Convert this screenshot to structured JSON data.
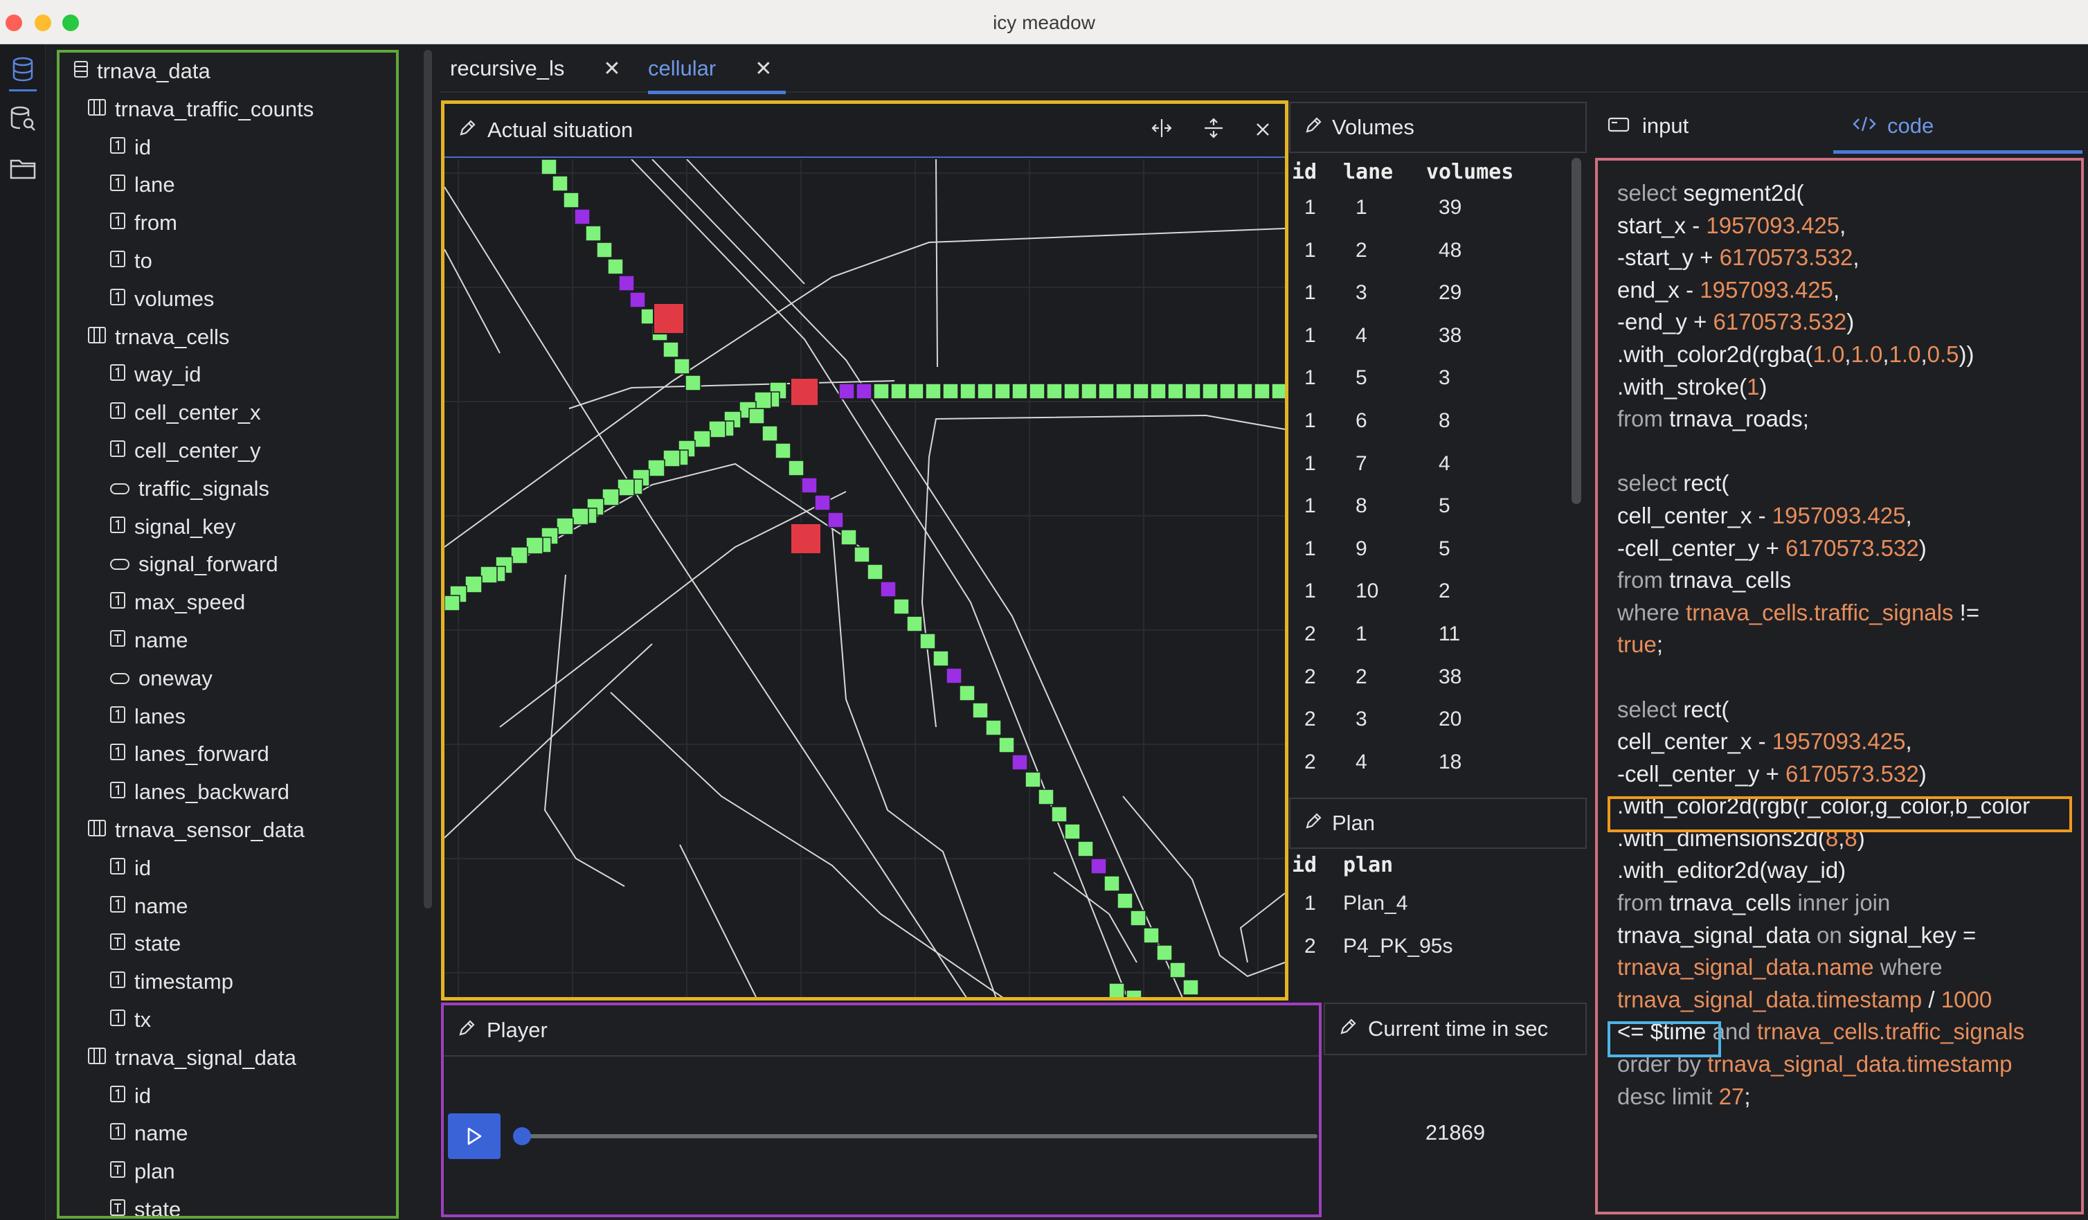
{
  "window": {
    "title": "icy meadow"
  },
  "rail": {
    "items": [
      "database-icon",
      "database-search-icon",
      "folder-icon"
    ]
  },
  "tree": {
    "items": [
      {
        "label": "trnava_data",
        "icon": "database-icon",
        "level": 0
      },
      {
        "label": "trnava_traffic_counts",
        "icon": "table-icon",
        "level": 1
      },
      {
        "label": "id",
        "icon": "number-icon",
        "level": 2
      },
      {
        "label": "lane",
        "icon": "number-icon",
        "level": 2
      },
      {
        "label": "from",
        "icon": "number-icon",
        "level": 2
      },
      {
        "label": "to",
        "icon": "number-icon",
        "level": 2
      },
      {
        "label": "volumes",
        "icon": "number-icon",
        "level": 2
      },
      {
        "label": "trnava_cells",
        "icon": "table-icon",
        "level": 1
      },
      {
        "label": "way_id",
        "icon": "number-icon",
        "level": 2
      },
      {
        "label": "cell_center_x",
        "icon": "number-icon",
        "level": 2
      },
      {
        "label": "cell_center_y",
        "icon": "number-icon",
        "level": 2
      },
      {
        "label": "traffic_signals",
        "icon": "boolean-icon",
        "level": 2
      },
      {
        "label": "signal_key",
        "icon": "number-icon",
        "level": 2
      },
      {
        "label": "signal_forward",
        "icon": "boolean-icon",
        "level": 2
      },
      {
        "label": "max_speed",
        "icon": "number-icon",
        "level": 2
      },
      {
        "label": "name",
        "icon": "text-icon",
        "level": 2
      },
      {
        "label": "oneway",
        "icon": "boolean-icon",
        "level": 2
      },
      {
        "label": "lanes",
        "icon": "number-icon",
        "level": 2
      },
      {
        "label": "lanes_forward",
        "icon": "number-icon",
        "level": 2
      },
      {
        "label": "lanes_backward",
        "icon": "number-icon",
        "level": 2
      },
      {
        "label": "trnava_sensor_data",
        "icon": "table-icon",
        "level": 1
      },
      {
        "label": "id",
        "icon": "number-icon",
        "level": 2
      },
      {
        "label": "name",
        "icon": "number-icon",
        "level": 2
      },
      {
        "label": "state",
        "icon": "text-icon",
        "level": 2
      },
      {
        "label": "timestamp",
        "icon": "number-icon",
        "level": 2
      },
      {
        "label": "tx",
        "icon": "number-icon",
        "level": 2
      },
      {
        "label": "trnava_signal_data",
        "icon": "table-icon",
        "level": 1
      },
      {
        "label": "id",
        "icon": "number-icon",
        "level": 2
      },
      {
        "label": "name",
        "icon": "number-icon",
        "level": 2
      },
      {
        "label": "plan",
        "icon": "text-icon",
        "level": 2
      },
      {
        "label": "state",
        "icon": "text-icon",
        "level": 2
      }
    ]
  },
  "tabs": [
    {
      "label": "recursive_ls",
      "close": "✕",
      "active": false
    },
    {
      "label": "cellular",
      "close": "✕",
      "active": true
    }
  ],
  "map_panel": {
    "title": "Actual situation"
  },
  "volumes_panel": {
    "title": "Volumes",
    "columns": [
      "id",
      "lane",
      "volumes"
    ],
    "rows": [
      [
        "1",
        "1",
        "39"
      ],
      [
        "1",
        "2",
        "48"
      ],
      [
        "1",
        "3",
        "29"
      ],
      [
        "1",
        "4",
        "38"
      ],
      [
        "1",
        "5",
        "3"
      ],
      [
        "1",
        "6",
        "8"
      ],
      [
        "1",
        "7",
        "4"
      ],
      [
        "1",
        "8",
        "5"
      ],
      [
        "1",
        "9",
        "5"
      ],
      [
        "1",
        "10",
        "2"
      ],
      [
        "2",
        "1",
        "11"
      ],
      [
        "2",
        "2",
        "38"
      ],
      [
        "2",
        "3",
        "20"
      ],
      [
        "2",
        "4",
        "18"
      ]
    ]
  },
  "plan_panel": {
    "title": "Plan",
    "columns": [
      "id",
      "plan"
    ],
    "rows": [
      [
        "1",
        "Plan_4"
      ],
      [
        "2",
        "P4_PK_95s"
      ]
    ]
  },
  "player_panel": {
    "title": "Player",
    "progress": 0.0
  },
  "time_panel": {
    "title": "Current time in sec",
    "value": "21869"
  },
  "right_tabs": [
    {
      "label": "input",
      "icon": "panel-icon",
      "active": false
    },
    {
      "label": "code",
      "icon": "code-icon",
      "active": true
    }
  ],
  "code_lines": [
    [
      [
        "kw",
        "select "
      ],
      [
        "t",
        "segment2d("
      ]
    ],
    [
      [
        "t",
        "start_x - "
      ],
      [
        "num",
        "1957093.425"
      ],
      [
        "t",
        ","
      ]
    ],
    [
      [
        "t",
        "-start_y + "
      ],
      [
        "num",
        "6170573.532"
      ],
      [
        "t",
        ","
      ]
    ],
    [
      [
        "t",
        "end_x - "
      ],
      [
        "num",
        "1957093.425"
      ],
      [
        "t",
        ","
      ]
    ],
    [
      [
        "t",
        "-end_y + "
      ],
      [
        "num",
        "6170573.532"
      ],
      [
        "t",
        ")"
      ]
    ],
    [
      [
        "t",
        ".with_color2d(rgba("
      ],
      [
        "num",
        "1.0"
      ],
      [
        "t",
        ","
      ],
      [
        "num",
        "1.0"
      ],
      [
        "t",
        ","
      ],
      [
        "num",
        "1.0"
      ],
      [
        "t",
        ","
      ],
      [
        "num",
        "0.5"
      ],
      [
        "t",
        "))"
      ]
    ],
    [
      [
        "t",
        ".with_stroke("
      ],
      [
        "num",
        "1"
      ],
      [
        "t",
        ")"
      ]
    ],
    [
      [
        "kw",
        "from "
      ],
      [
        "t",
        "trnava_roads;"
      ]
    ],
    [],
    [
      [
        "kw",
        "select "
      ],
      [
        "t",
        "rect("
      ]
    ],
    [
      [
        "t",
        "cell_center_x - "
      ],
      [
        "num",
        "1957093.425"
      ],
      [
        "t",
        ","
      ]
    ],
    [
      [
        "t",
        "-cell_center_y + "
      ],
      [
        "num",
        "6170573.532"
      ],
      [
        "t",
        ")"
      ]
    ],
    [
      [
        "kw",
        "from "
      ],
      [
        "t",
        "trnava_cells"
      ]
    ],
    [
      [
        "kw",
        "where "
      ],
      [
        "ref",
        "trnava_cells.traffic_signals"
      ],
      [
        "t",
        " !="
      ]
    ],
    [
      [
        "num",
        "true"
      ],
      [
        "t",
        ";"
      ]
    ],
    [],
    [
      [
        "kw",
        "select "
      ],
      [
        "t",
        "rect("
      ]
    ],
    [
      [
        "t",
        "cell_center_x - "
      ],
      [
        "num",
        "1957093.425"
      ],
      [
        "t",
        ","
      ]
    ],
    [
      [
        "t",
        "-cell_center_y + "
      ],
      [
        "num",
        "6170573.532"
      ],
      [
        "t",
        ")"
      ]
    ],
    [
      [
        "t",
        ".with_color2d(rgb(r_color,g_color,b_color"
      ]
    ],
    [
      [
        "t",
        ".with_dimensions2d("
      ],
      [
        "num",
        "8"
      ],
      [
        "t",
        ","
      ],
      [
        "num",
        "8"
      ],
      [
        "t",
        ")"
      ]
    ],
    [
      [
        "t",
        ".with_editor2d(way_id)"
      ]
    ],
    [
      [
        "kw",
        "from "
      ],
      [
        "t",
        "trnava_cells "
      ],
      [
        "kw",
        "inner join"
      ]
    ],
    [
      [
        "t",
        "trnava_signal_data "
      ],
      [
        "kw",
        "on "
      ],
      [
        "t",
        "signal_key ="
      ]
    ],
    [
      [
        "ref",
        "trnava_signal_data.name "
      ],
      [
        "kw",
        "where"
      ]
    ],
    [
      [
        "ref",
        "trnava_signal_data.timestamp"
      ],
      [
        "t",
        " / "
      ],
      [
        "num",
        "1000"
      ]
    ],
    [
      [
        "t",
        "<= $time "
      ],
      [
        "kw",
        "and "
      ],
      [
        "ref",
        "trnava_cells.traffic_signals"
      ]
    ],
    [
      [
        "kw",
        "order by "
      ],
      [
        "ref",
        "trnava_signal_data.timestamp"
      ]
    ],
    [
      [
        "kw",
        "desc limit "
      ],
      [
        "num",
        "27"
      ],
      [
        "t",
        ";"
      ]
    ]
  ],
  "colors": {
    "tree_border": "#5fa83a",
    "map_border": "#e3b423",
    "player_border": "#9d3fc1",
    "code_border": "#d0707f",
    "accent": "#4a7bd6",
    "cell_green": "#7ef27a",
    "cell_purple": "#9a2fe6",
    "signal_red": "#e23a45"
  }
}
